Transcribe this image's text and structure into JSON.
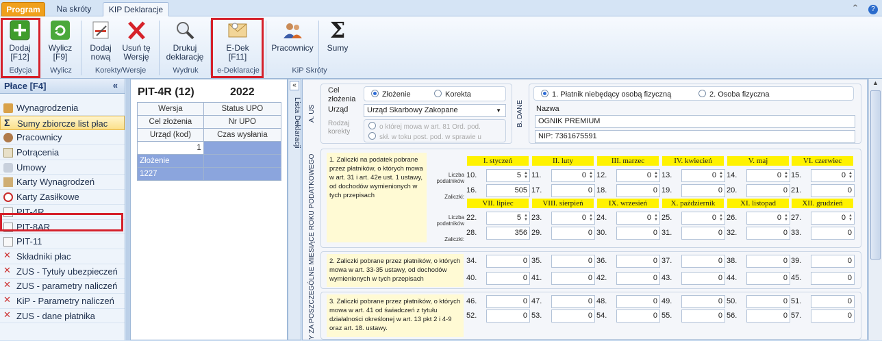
{
  "tabs": {
    "program": "Program",
    "na_skroty": "Na skróty",
    "kip": "KIP Deklaracje"
  },
  "window_controls": "⌃ ❷",
  "ribbon": {
    "buttons": [
      {
        "id": "dodaj",
        "l1": "Dodaj",
        "l2": "[F12]",
        "icon": "add-icon"
      },
      {
        "id": "wylicz",
        "l1": "Wylicz",
        "l2": "[F9]",
        "icon": "refresh-icon"
      },
      {
        "id": "dodaj_nowa",
        "l1": "Dodaj",
        "l2": "nową",
        "icon": "new-document-icon"
      },
      {
        "id": "usun",
        "l1": "Usuń tę",
        "l2": "Wersję",
        "icon": "delete-icon"
      },
      {
        "id": "drukuj",
        "l1": "Drukuj",
        "l2": "deklarację",
        "icon": "print-preview-icon"
      },
      {
        "id": "edek",
        "l1": "E-Dek",
        "l2": "[F11]",
        "icon": "email-icon"
      },
      {
        "id": "pracownicy",
        "l1": "Pracownicy",
        "l2": "",
        "icon": "people-icon"
      },
      {
        "id": "sumy",
        "l1": "Sumy",
        "l2": "",
        "icon": "sigma-icon"
      }
    ],
    "groups": [
      "Edycja",
      "Wylicz",
      "Korekty/Wersje",
      "Wydruk",
      "e-Deklaracje",
      "KiP Skróty"
    ]
  },
  "left": {
    "title": "Płace [F4]",
    "collapse": "«",
    "items": [
      "Wynagrodzenia",
      "Sumy zbiorcze list płac",
      "Pracownicy",
      "Potrącenia",
      "Umowy",
      "Karty Wynagrodzeń",
      "Karty Zasiłkowe",
      "PIT-4R",
      "PIT-8AR",
      "PIT-11",
      "Składniki płac",
      "ZUS - Tytuły ubezpieczeń",
      "ZUS - parametry naliczeń",
      "KiP - Parametry naliczeń",
      "ZUS - dane płatnika"
    ]
  },
  "mid": {
    "title": "PIT-4R (12)",
    "year": "2022",
    "headers": [
      [
        "Wersja",
        "Status UPO"
      ],
      [
        "Cel złożenia",
        "Nr UPO"
      ],
      [
        "Urząd (kod)",
        "Czas wysłania"
      ]
    ],
    "rows": [
      [
        "1",
        ""
      ],
      [
        "Złożenie",
        ""
      ],
      [
        "1227",
        ""
      ]
    ]
  },
  "lista_deklaracji": "Lista Deklaracji",
  "section_a": {
    "label": "A. US",
    "cel_label": "Cel złożenia",
    "zlozenie": "Złożenie",
    "korekta": "Korekta",
    "urzad_label": "Urząd",
    "urzad_value": "Urząd Skarbowy Zakopane",
    "rodzaj_label": "Rodzaj korekty",
    "rodzaj_opt1": "o której mowa w art. 81 Ord. pod.",
    "rodzaj_opt2": "skł. w toku post. pod. w sprawie u"
  },
  "section_b": {
    "label": "B. DANE",
    "opt1": "1. Płatnik niebędący osobą fizyczną",
    "opt2": "2. Osoba fizyczna",
    "nazwa_label": "Nazwa",
    "nazwa_value": "OGNIK PREMIUM",
    "nip_value": "NIP: 7361675591"
  },
  "section_main_label": "Y ZA POSZCZEGÓLNE MIESIĄCE ROKU PODATKOWEGO",
  "s1": {
    "text": "1. Zaliczki na podatek pobrane przez płatników, o których mowa w art. 31 i art. 42e ust. 1 ustawy, od dochodów wymienionych w tych przepisach",
    "liczba": "Liczba podatników",
    "zaliczki": "Zaliczki:",
    "months1": [
      "I. styczeń",
      "II. luty",
      "III. marzec",
      "IV. kwiecień",
      "V. maj",
      "VI. czerwiec"
    ],
    "months2": [
      "VII. lipiec",
      "VIII. sierpień",
      "IX. wrzesień",
      "X. październik",
      "XI. listopad",
      "XII. grudzień"
    ],
    "r1": [
      [
        "10.",
        "5"
      ],
      [
        "11.",
        "0"
      ],
      [
        "12.",
        "0"
      ],
      [
        "13.",
        "0"
      ],
      [
        "14.",
        "0"
      ],
      [
        "15.",
        "0"
      ]
    ],
    "r2": [
      [
        "16.",
        "505"
      ],
      [
        "17.",
        "0"
      ],
      [
        "18.",
        "0"
      ],
      [
        "19.",
        "0"
      ],
      [
        "20.",
        "0"
      ],
      [
        "21.",
        "0"
      ]
    ],
    "r3": [
      [
        "22.",
        "5"
      ],
      [
        "23.",
        "0"
      ],
      [
        "24.",
        "0"
      ],
      [
        "25.",
        "0"
      ],
      [
        "26.",
        "0"
      ],
      [
        "27.",
        "0"
      ]
    ],
    "r4": [
      [
        "28.",
        "356"
      ],
      [
        "29.",
        "0"
      ],
      [
        "30.",
        "0"
      ],
      [
        "31.",
        "0"
      ],
      [
        "32.",
        "0"
      ],
      [
        "33.",
        "0"
      ]
    ]
  },
  "s2": {
    "text": "2. Zaliczki pobrane przez płatników, o których mowa w art. 33-35 ustawy, od dochodów wymienionych w tych przepisach",
    "r1": [
      [
        "34.",
        "0"
      ],
      [
        "35.",
        "0"
      ],
      [
        "36.",
        "0"
      ],
      [
        "37.",
        "0"
      ],
      [
        "38.",
        "0"
      ],
      [
        "39.",
        "0"
      ]
    ],
    "r2": [
      [
        "40.",
        "0"
      ],
      [
        "41.",
        "0"
      ],
      [
        "42.",
        "0"
      ],
      [
        "43.",
        "0"
      ],
      [
        "44.",
        "0"
      ],
      [
        "45.",
        "0"
      ]
    ]
  },
  "s3": {
    "text": "3. Zaliczki pobrane przez płatników, o których mowa w art. 41 od świadczeń z tytułu działalności określonej w art. 13 pkt 2 i 4-9 oraz art. 18. ustawy.",
    "r1": [
      [
        "46.",
        "0"
      ],
      [
        "47.",
        "0"
      ],
      [
        "48.",
        "0"
      ],
      [
        "49.",
        "0"
      ],
      [
        "50.",
        "0"
      ],
      [
        "51.",
        "0"
      ]
    ],
    "r2": [
      [
        "52.",
        "0"
      ],
      [
        "53.",
        "0"
      ],
      [
        "54.",
        "0"
      ],
      [
        "55.",
        "0"
      ],
      [
        "56.",
        "0"
      ],
      [
        "57.",
        "0"
      ]
    ]
  },
  "colors": {
    "accent": "#f0a01c",
    "highlight_red": "#d5202a",
    "month_yellow": "#fff200",
    "selected_row": "#8ba5dd"
  }
}
